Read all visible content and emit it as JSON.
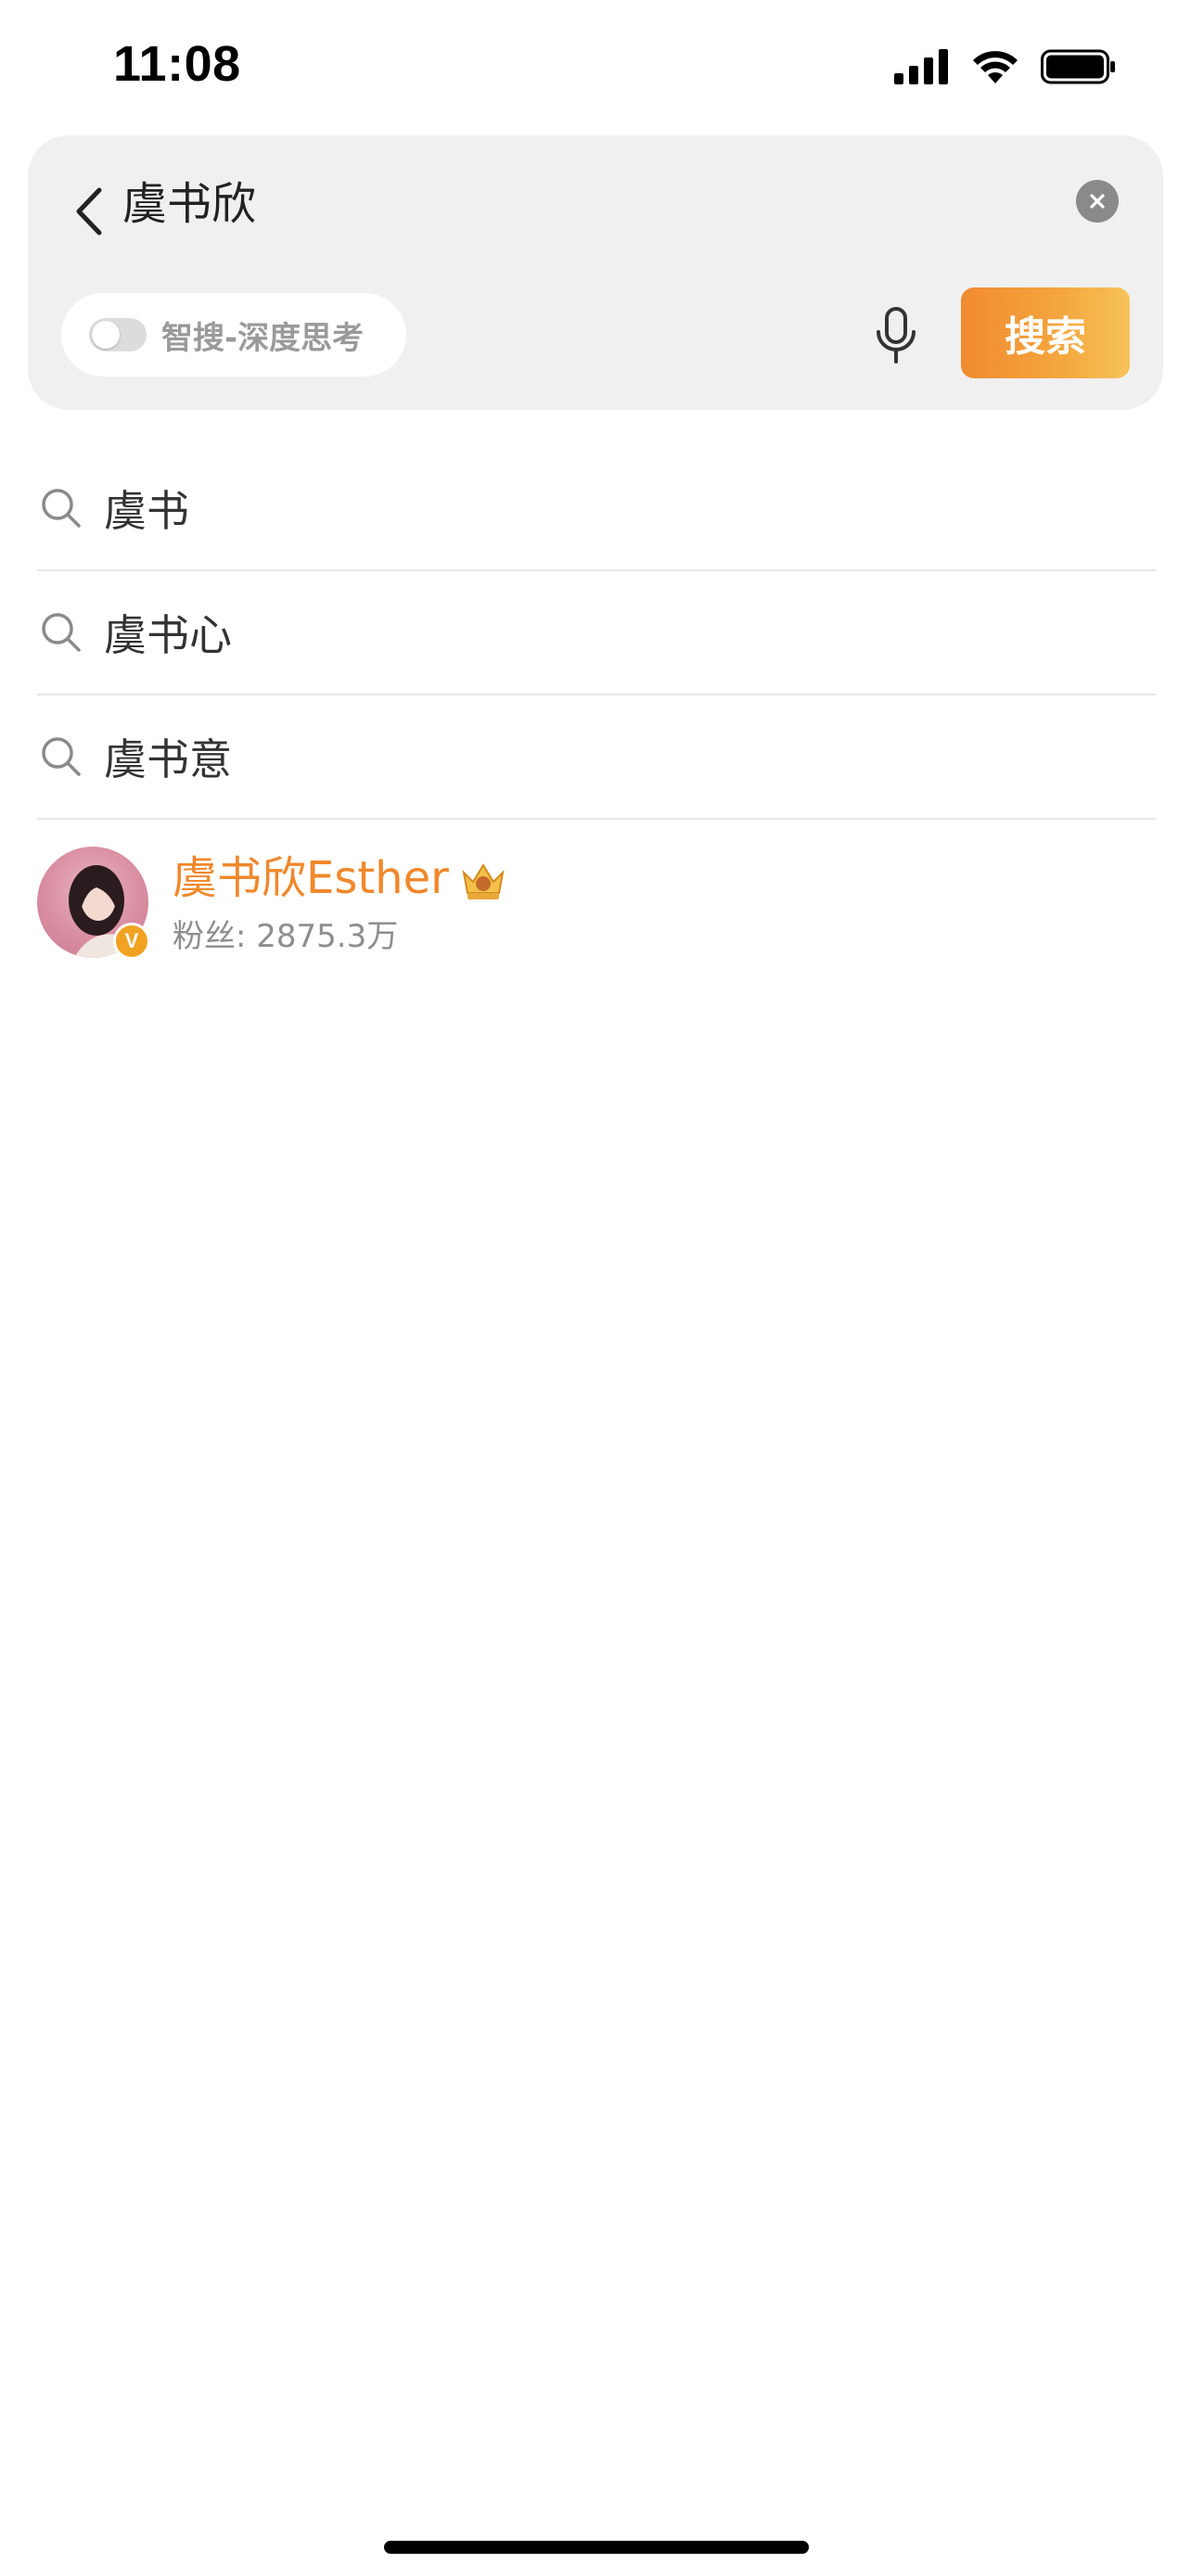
{
  "status_bar": {
    "time": "11:08"
  },
  "search": {
    "query": "虞书欣",
    "toggle_label": "智搜-深度思考",
    "toggle_on": false,
    "search_button_label": "搜索",
    "accent_gradient": [
      "#f08a30",
      "#f6c35a"
    ]
  },
  "suggestions": [
    {
      "label": "虞书",
      "icon": "search-icon"
    },
    {
      "label": "虞书心",
      "icon": "search-icon"
    },
    {
      "label": "虞书意",
      "icon": "search-icon"
    }
  ],
  "user_result": {
    "name": "虞书欣Esther",
    "fans": "粉丝: 2875.3万",
    "verified_badge": "V",
    "name_color": "#f0882c"
  }
}
